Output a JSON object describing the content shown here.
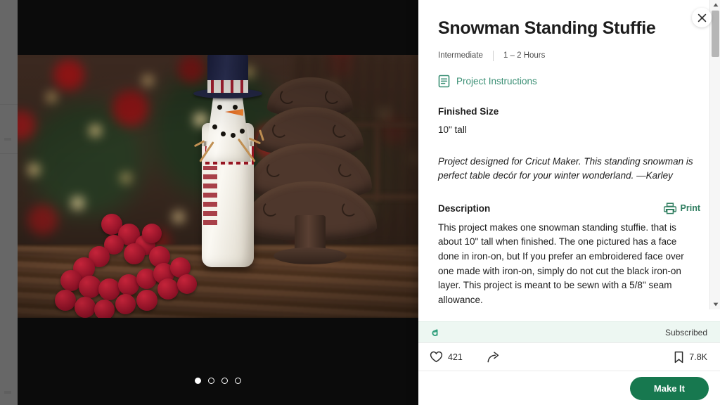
{
  "panel": {
    "title": "Snowman Standing Stuffie",
    "close_icon": "close-icon",
    "meta": {
      "difficulty": "Intermediate",
      "duration": "1 – 2 Hours"
    },
    "instructions_link": {
      "label": "Project Instructions",
      "icon": "document-icon",
      "color": "#3a8f74"
    },
    "finished_size": {
      "heading": "Finished Size",
      "value": "10\" tall"
    },
    "designer_note": "Project designed for Cricut Maker. This standing snowman is perfect table decór for your winter wonderland. —Karley",
    "description": {
      "heading": "Description",
      "print_label": "Print",
      "print_icon": "printer-icon",
      "body": "This project makes one snowman standing stuffie. that is about 10\" tall when finished. The one pictured has a face done in iron-on, but If you prefer an embroidered face over one made with iron-on, simply do not cut the black iron-on layer. This project is meant to be sewn with a 5/8\" seam allowance."
    },
    "subscription": {
      "logo_icon": "cricut-access-a-icon",
      "status": "Subscribed",
      "bar_color": "#edf7f2",
      "logo_color": "#2e9e7b"
    },
    "actions": {
      "like": {
        "icon": "heart-icon",
        "count": "421"
      },
      "share": {
        "icon": "share-arrow-icon"
      },
      "save": {
        "icon": "bookmark-icon",
        "count": "7.8K"
      }
    },
    "cta": {
      "label": "Make It",
      "color": "#17784f"
    },
    "scrollbar": {
      "up_arrow": "scroll-up-arrow-icon",
      "down_arrow": "scroll-down-arrow-icon"
    }
  },
  "media": {
    "alt": "Snowman standing stuffie on a wooden table with a Christmas tree, wooden tree decor and red felt ball garland",
    "carousel": {
      "total": 4,
      "active_index": 0
    }
  }
}
